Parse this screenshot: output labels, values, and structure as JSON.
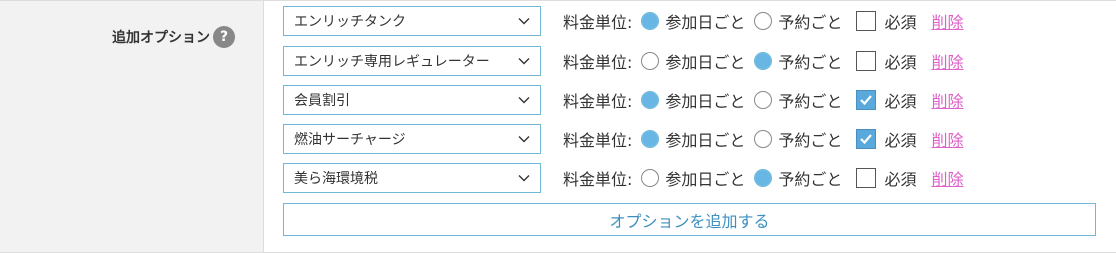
{
  "field_label": "追加オプション",
  "help_icon": "?",
  "unit_label": "料金単位:",
  "per_day_label": "参加日ごと",
  "per_booking_label": "予約ごと",
  "required_label": "必須",
  "delete_label": "削除",
  "add_button_label": "オプションを追加する",
  "options": [
    {
      "name": "エンリッチタンク",
      "unit": "per_day",
      "required": false
    },
    {
      "name": "エンリッチ専用レギュレーター",
      "unit": "per_booking",
      "required": false
    },
    {
      "name": "会員割引",
      "unit": "per_day",
      "required": true
    },
    {
      "name": "燃油サーチャージ",
      "unit": "per_day",
      "required": true
    },
    {
      "name": "美ら海環境税",
      "unit": "per_booking",
      "required": false
    }
  ],
  "colors": {
    "accent_border": "#6fb8d8",
    "radio_fill": "#67b6e4",
    "checkbox_fill": "#5aa9dc",
    "delete_link": "#e05fc8",
    "button_text": "#3d8fc0"
  }
}
